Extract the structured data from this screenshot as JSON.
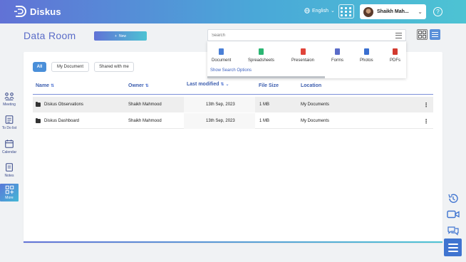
{
  "header": {
    "app_name": "Diskus",
    "language": "English",
    "user_name": "Shaikh Mah...",
    "help_label": "?"
  },
  "page": {
    "title": "Data Room",
    "new_button": "New",
    "search_placeholder": "Search"
  },
  "search_dropdown": {
    "types": [
      {
        "label": "Document",
        "color": "#4a7fd6"
      },
      {
        "label": "Spreadsheets",
        "color": "#2bb673"
      },
      {
        "label": "Presentaion",
        "color": "#e0443a"
      },
      {
        "label": "Forms",
        "color": "#5a6cc8"
      },
      {
        "label": "Photos",
        "color": "#3a6fd0"
      },
      {
        "label": "PDFs",
        "color": "#d23a2f"
      }
    ],
    "show_options": "Show Search Options"
  },
  "tabs": [
    "All",
    "My Document",
    "Shared with me"
  ],
  "table": {
    "columns": [
      "Name",
      "Owner",
      "Last modified",
      "File Size",
      "Location"
    ],
    "rows": [
      {
        "name": "Diskus Observations",
        "owner": "Shaikh Mahmood",
        "modified": "13th Sep, 2023",
        "size": "1 MB",
        "location": "My Documents"
      },
      {
        "name": "Diskus Dashboard",
        "owner": "Shaikh Mahmood",
        "modified": "13th Sep, 2023",
        "size": "1 MB",
        "location": "My Documents"
      }
    ]
  },
  "sidebar": {
    "items": [
      "Meeting",
      "To Do list",
      "Calendar",
      "Notes",
      "More"
    ]
  },
  "colors": {
    "accent": "#5a6cc8",
    "header_gradient_start": "#6172d6",
    "header_gradient_end": "#4dc3d3",
    "active_tab": "#4a8fd9"
  }
}
